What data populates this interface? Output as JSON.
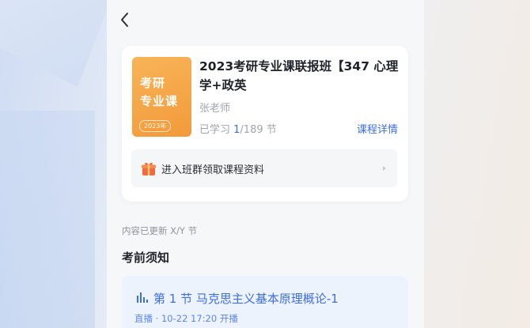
{
  "course": {
    "cover": {
      "line1": "考研",
      "line2": "专业课",
      "year": "2023年"
    },
    "title": "2023考研专业课联报班【347 心理学+政英",
    "teacher": "张老师",
    "progress": {
      "prefix": "已学习 ",
      "current": "1",
      "suffix": "/189 节"
    },
    "detail_link": "课程详情",
    "group_banner": "进入班群领取课程资料"
  },
  "update_info": "内容已更新 X/Y 节",
  "section_title": "考前须知",
  "lesson": {
    "title": "第 1 节  马克思主义基本原理概论-1",
    "meta": "直播 · 10-22 17:20 开播"
  },
  "colors": {
    "accent": "#3d6de6",
    "cover_orange": "#f29a3a",
    "lesson_bg": "#edf3fd"
  },
  "icons": {
    "back": "chevron-left-icon",
    "gift": "gift-icon",
    "arrow": "caret-right-icon",
    "playing": "audio-bars-icon"
  }
}
